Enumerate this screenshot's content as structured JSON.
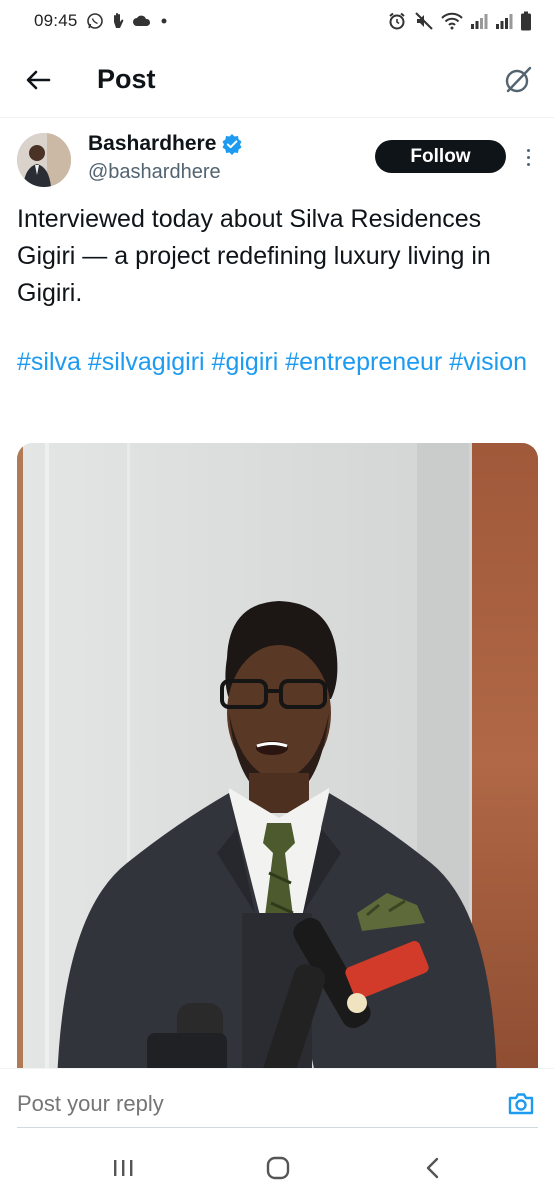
{
  "status_bar": {
    "time": "09:45",
    "left_icons": [
      "whatsapp-icon",
      "hand-icon",
      "cloud-icon",
      "dot-icon"
    ],
    "right_icons": [
      "alarm-icon",
      "mute-icon",
      "wifi-icon",
      "signal-icon",
      "signal-icon",
      "battery-icon"
    ]
  },
  "header": {
    "title": "Post",
    "back_icon": "arrow-left-icon",
    "grok_icon": "grok-icon"
  },
  "author": {
    "name": "Bashardhere",
    "handle": "@bashardhere",
    "verified_icon": "verified-badge-icon",
    "follow_label": "Follow"
  },
  "tweet": {
    "text": "Interviewed today about Silva Residences Gigiri — a project redefining luxury living in Gigiri.",
    "hashtags": [
      "#silva",
      "#silvagigiri",
      "#gigiri",
      "#entrepreneur",
      "#vision"
    ]
  },
  "reply": {
    "placeholder": "Post your reply",
    "camera_icon": "camera-icon"
  },
  "nav": {
    "recents_icon": "recents-icon",
    "home_icon": "home-icon",
    "back_icon": "back-chevron-icon"
  },
  "colors": {
    "accent": "#1d9bf0",
    "text": "#0f1419",
    "secondary": "#536471",
    "follow_bg": "#0f1419"
  }
}
